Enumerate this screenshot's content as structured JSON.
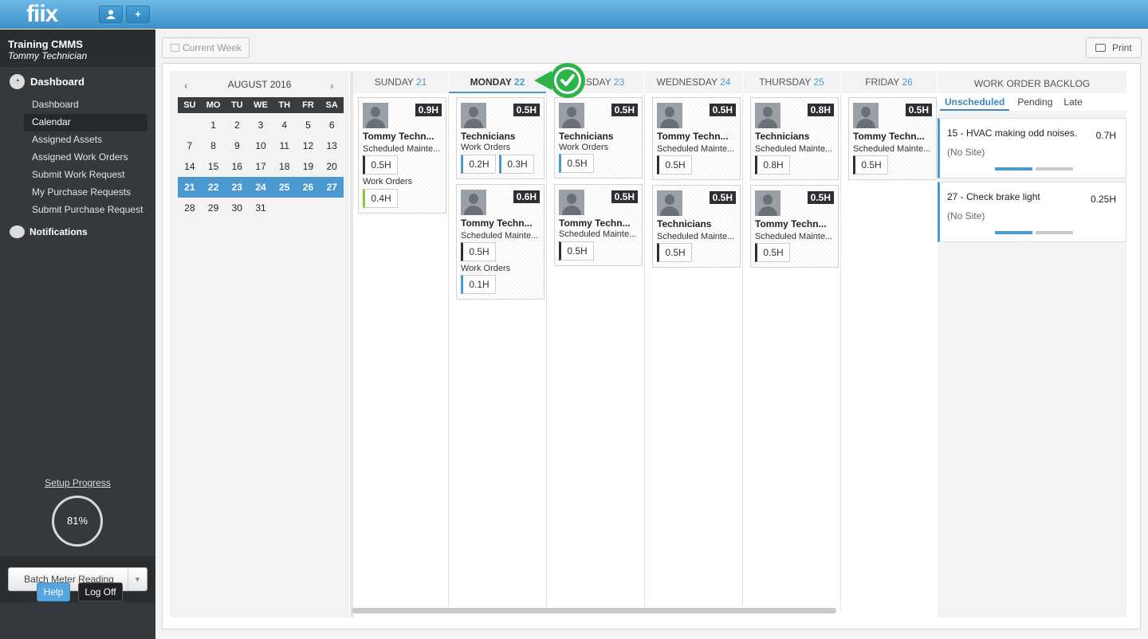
{
  "app": {
    "logo": "fiix"
  },
  "topbar": {
    "user_icon": "user-icon",
    "add_icon": "+"
  },
  "sidebar": {
    "org_title": "Training CMMS",
    "user_name": "Tommy Technician",
    "dashboard_header": "Dashboard",
    "nav_items": [
      {
        "label": "Dashboard"
      },
      {
        "label": "Calendar"
      },
      {
        "label": "Assigned Assets"
      },
      {
        "label": "Assigned Work Orders"
      },
      {
        "label": "Submit Work Request"
      },
      {
        "label": "My Purchase Requests"
      },
      {
        "label": "Submit Purchase Request"
      }
    ],
    "notifications": "Notifications",
    "setup_progress": "Setup Progress",
    "progress_percent": "81%",
    "batch_meter": "Batch Meter Reading",
    "help": "Help",
    "log_off": "Log Off"
  },
  "toolbar": {
    "current_week": "Current Week",
    "print": "Print"
  },
  "mini_calendar": {
    "month": "AUGUST 2016",
    "dow": [
      "SU",
      "MO",
      "TU",
      "WE",
      "TH",
      "FR",
      "SA"
    ],
    "weeks": [
      [
        "",
        "1",
        "2",
        "3",
        "4",
        "5",
        "6"
      ],
      [
        "7",
        "8",
        "9",
        "10",
        "11",
        "12",
        "13"
      ],
      [
        "14",
        "15",
        "16",
        "17",
        "18",
        "19",
        "20"
      ],
      [
        "21",
        "22",
        "23",
        "24",
        "25",
        "26",
        "27"
      ],
      [
        "28",
        "29",
        "30",
        "31",
        "",
        "",
        ""
      ]
    ],
    "selected_week": 3
  },
  "schedule": {
    "days": [
      {
        "name": "SUNDAY",
        "num": "21"
      },
      {
        "name": "MONDAY",
        "num": "22"
      },
      {
        "name": "TUESDAY",
        "num": "23"
      },
      {
        "name": "WEDNESDAY",
        "num": "24"
      },
      {
        "name": "THURSDAY",
        "num": "25"
      },
      {
        "name": "FRIDAY",
        "num": "26"
      }
    ],
    "cards": {
      "sun1": {
        "hours": "0.9H",
        "name": "Tommy Techn...",
        "l1": "Scheduled Mainte...",
        "p1": "0.5H",
        "l2": "Work Orders",
        "p2": "0.4H"
      },
      "mon1": {
        "hours": "0.5H",
        "name": "Technicians",
        "l1": "Work Orders",
        "p1": "0.2H",
        "p2": "0.3H"
      },
      "mon2": {
        "hours": "0.6H",
        "name": "Tommy Techn...",
        "l1": "Scheduled Mainte...",
        "p1": "0.5H",
        "l2": "Work Orders",
        "p2": "0.1H"
      },
      "tue1": {
        "hours": "0.5H",
        "name": "Technicians",
        "l1": "Work Orders",
        "p1": "0.5H"
      },
      "tue2": {
        "hours": "0.5H",
        "name": "Tommy Techn...",
        "l1": "Scheduled Mainte...",
        "p1": "0.5H"
      },
      "wed1": {
        "hours": "0.5H",
        "name": "Tommy Techn...",
        "l1": "Scheduled Mainte...",
        "p1": "0.5H"
      },
      "wed2": {
        "hours": "0.5H",
        "name": "Technicians",
        "l1": "Scheduled Mainte...",
        "p1": "0.5H"
      },
      "thu1": {
        "hours": "0.8H",
        "name": "Technicians",
        "l1": "Scheduled Mainte...",
        "p1": "0.8H"
      },
      "thu2": {
        "hours": "0.5H",
        "name": "Tommy Techn...",
        "l1": "Scheduled Mainte...",
        "p1": "0.5H"
      },
      "fri1": {
        "hours": "0.5H",
        "name": "Tommy Techn...",
        "l1": "Scheduled Mainte...",
        "p1": "0.5H"
      }
    }
  },
  "backlog": {
    "title": "WORK ORDER BACKLOG",
    "tabs": [
      "Unscheduled",
      "Pending",
      "Late"
    ],
    "items": [
      {
        "title": "15 - HVAC making odd noises.",
        "hours": "0.7H",
        "site": "(No Site)"
      },
      {
        "title": "27 - Check brake light",
        "hours": "0.25H",
        "site": "(No Site)"
      }
    ]
  },
  "colors": {
    "accent": "#4a9ad1",
    "sidebar": "#35383c",
    "check": "#2db34a"
  }
}
